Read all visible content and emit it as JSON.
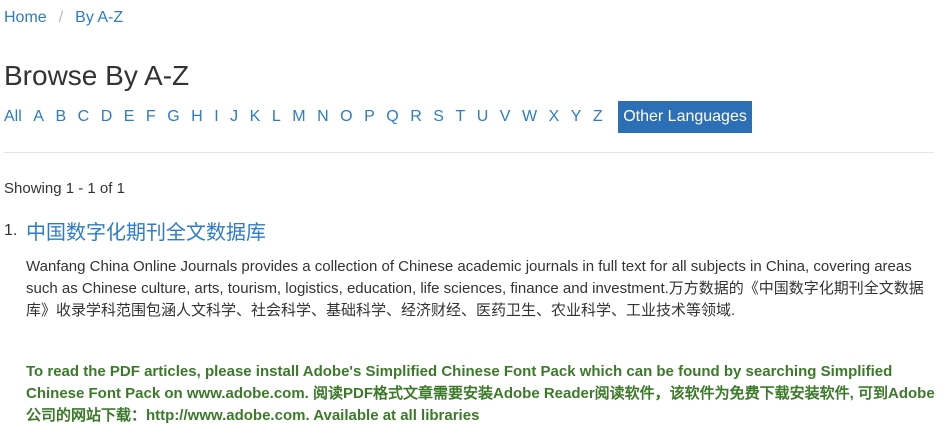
{
  "breadcrumb": {
    "home": "Home",
    "separator": "/",
    "current": "By A-Z"
  },
  "page": {
    "title": "Browse By A-Z"
  },
  "az": {
    "all": "All",
    "letters": [
      "A",
      "B",
      "C",
      "D",
      "E",
      "F",
      "G",
      "H",
      "I",
      "J",
      "K",
      "L",
      "M",
      "N",
      "O",
      "P",
      "Q",
      "R",
      "S",
      "T",
      "U",
      "V",
      "W",
      "X",
      "Y",
      "Z"
    ],
    "other_languages": "Other Languages"
  },
  "results": {
    "showing": "Showing 1 - 1 of 1",
    "items": [
      {
        "number": "1.",
        "title": "中国数字化期刊全文数据库",
        "description": "Wanfang China Online Journals provides a collection of Chinese academic journals in full text for all subjects in China, covering areas such as Chinese culture, arts, tourism, logistics, education, life sciences, finance and investment.万方数据的《中国数字化期刊全文数据库》收录学科范围包涵人文科学、社会科学、基础科学、经济财经、医药卫生、农业科学、工业技术等领域.",
        "note": "To read the PDF articles, please install Adobe's Simplified Chinese Font Pack which can be found by searching Simplified Chinese Font Pack on www.adobe.com. 阅读PDF格式文章需要安装Adobe Reader阅读软件，该软件为免费下载安装软件, 可到Adobe公司的网站下载：http://www.adobe.com. Available at all libraries"
      }
    ]
  },
  "colors": {
    "link": "#2c7cc9",
    "button_bg": "#2c6fb6",
    "note_text": "#3c7a2a"
  }
}
